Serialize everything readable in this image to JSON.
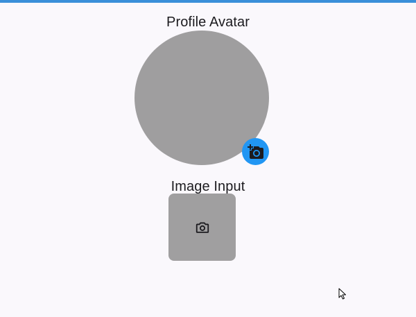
{
  "profile_avatar": {
    "title": "Profile Avatar",
    "add_photo_icon": "add-a-photo-icon",
    "avatar_color": "#9f9e9f",
    "button_color": "#2196f3"
  },
  "image_input": {
    "title": "Image Input",
    "camera_icon": "camera-icon",
    "box_color": "#a09fa0"
  },
  "colors": {
    "accent": "#3a8fd9",
    "background": "#faf8fc"
  }
}
